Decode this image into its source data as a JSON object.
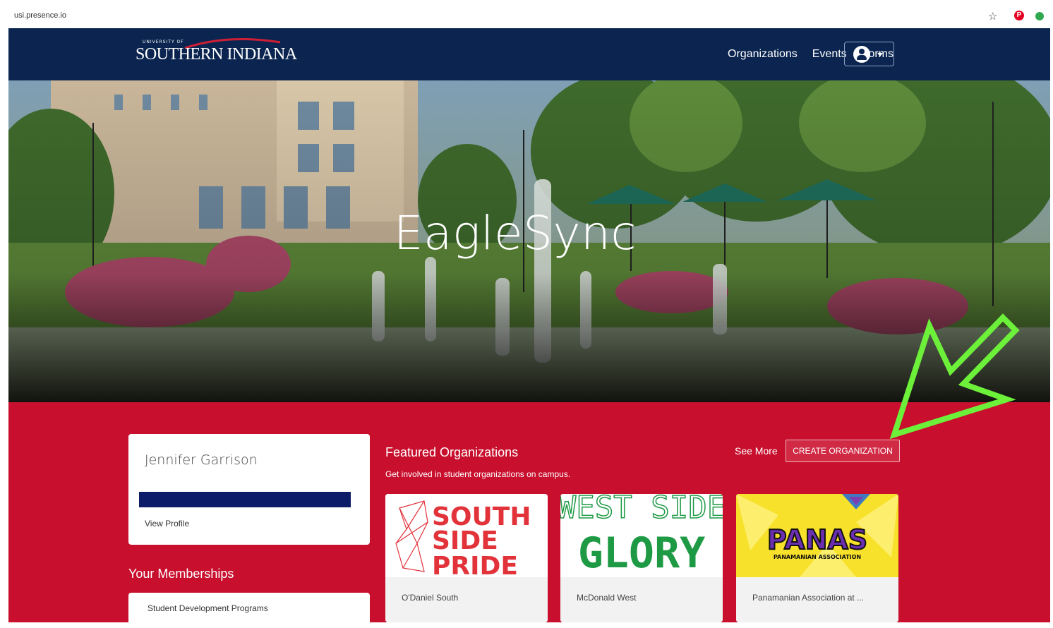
{
  "browser": {
    "url": "usi.presence.io"
  },
  "colors": {
    "nav_bg": "#0b2550",
    "content_bg": "#c8102e",
    "arrow": "#6cf03a"
  },
  "nav": {
    "logo_small": "UNIVERSITY OF",
    "logo_text": "SOUTHERN INDIANA",
    "links": [
      "Organizations",
      "Events",
      "Forms"
    ]
  },
  "hero": {
    "title": "EagleSync"
  },
  "profile": {
    "name": "Jennifer Garrison",
    "view_profile": "View Profile"
  },
  "memberships": {
    "title": "Your Memberships",
    "items": [
      "Student Development Programs"
    ]
  },
  "featured": {
    "title": "Featured Organizations",
    "subtitle": "Get involved in student organizations on campus.",
    "see_more": "See More",
    "create_button": "CREATE ORGANIZATION",
    "orgs": [
      {
        "name": "O'Daniel South",
        "logo_text": [
          "SOUTH",
          "SIDE",
          "PRIDE"
        ]
      },
      {
        "name": "McDonald West",
        "logo_text": [
          "WEST SIDE",
          "GLORY"
        ]
      },
      {
        "name": "Panamanian Association at ...",
        "logo_text": [
          "PANAS",
          "PANAMANIAN ASSOCIATION"
        ]
      }
    ]
  }
}
